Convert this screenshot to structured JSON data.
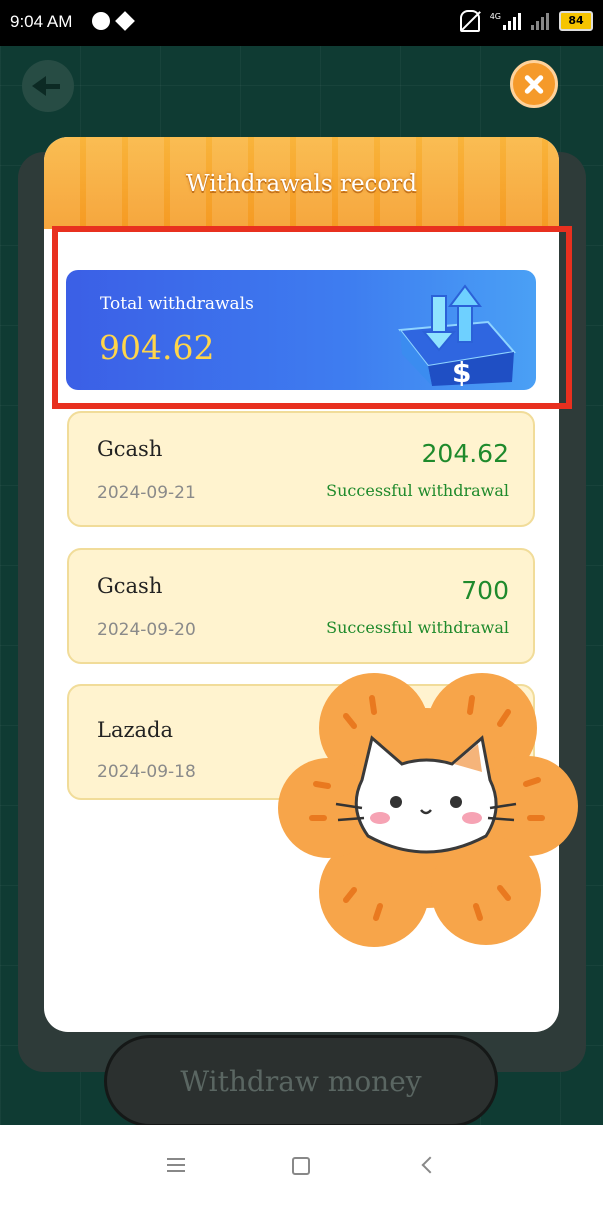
{
  "status_bar": {
    "time": "9:04 AM",
    "network": "4G",
    "battery": "84",
    "icons": [
      "messenger-icon",
      "dropbox-icon",
      "mute-bell-icon",
      "signal-icon",
      "wifi-icon",
      "battery-icon"
    ]
  },
  "game": {
    "withdraw_button": "Withdraw money"
  },
  "dialog": {
    "title": "Withdrawals record",
    "total": {
      "label": "Total withdrawals",
      "value": "904.62"
    },
    "records": [
      {
        "method": "Gcash",
        "date": "2024-09-21",
        "amount": "204.62",
        "status": "Successful withdrawal"
      },
      {
        "method": "Gcash",
        "date": "2024-09-20",
        "amount": "700",
        "status": "Successful withdrawal"
      },
      {
        "method": "Lazada",
        "date": "2024-09-18",
        "amount": "",
        "status": ""
      }
    ]
  },
  "colors": {
    "header_orange": "#f59a23",
    "card_blue": "#3e7df0",
    "amount_gold": "#ffd54a",
    "success_green": "#1f8a2c",
    "record_bg": "#fff3cf",
    "highlight_red": "#e8301f"
  }
}
